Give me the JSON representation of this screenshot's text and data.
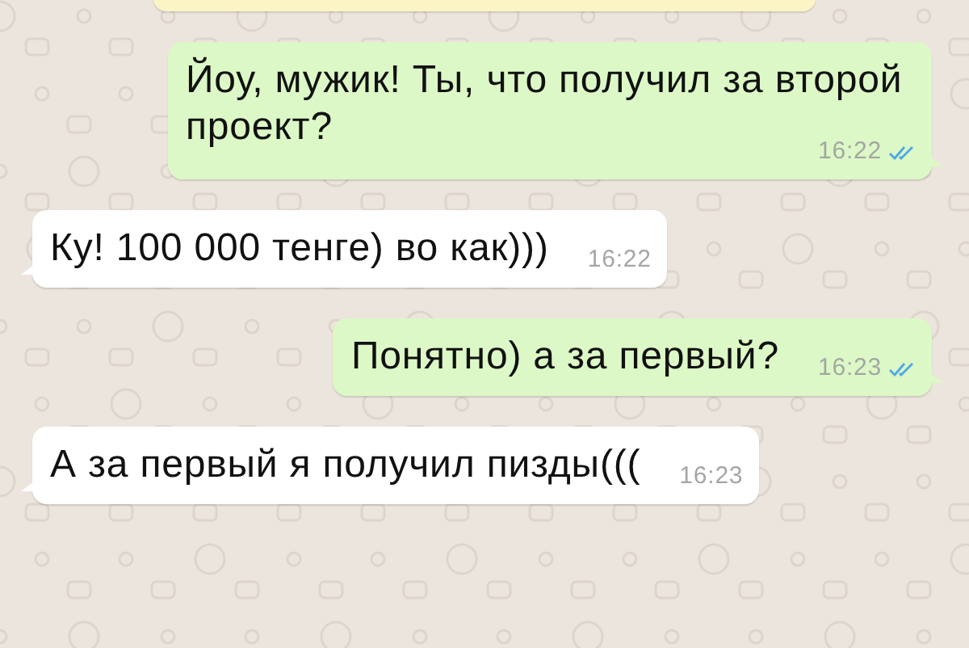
{
  "messages": [
    {
      "kind": "system"
    },
    {
      "kind": "outgoing",
      "text": "Йоу, мужик! Ты, что получил за второй проект?",
      "time": "16:22",
      "read": true
    },
    {
      "kind": "incoming",
      "text": "Ку! 100 000 тенге) во как)))",
      "time": "16:22"
    },
    {
      "kind": "outgoing",
      "text": "Понятно) а за первый?",
      "time": "16:23",
      "read": true
    },
    {
      "kind": "incoming",
      "text": "А за первый я получил пизды(((",
      "time": "16:23"
    }
  ]
}
